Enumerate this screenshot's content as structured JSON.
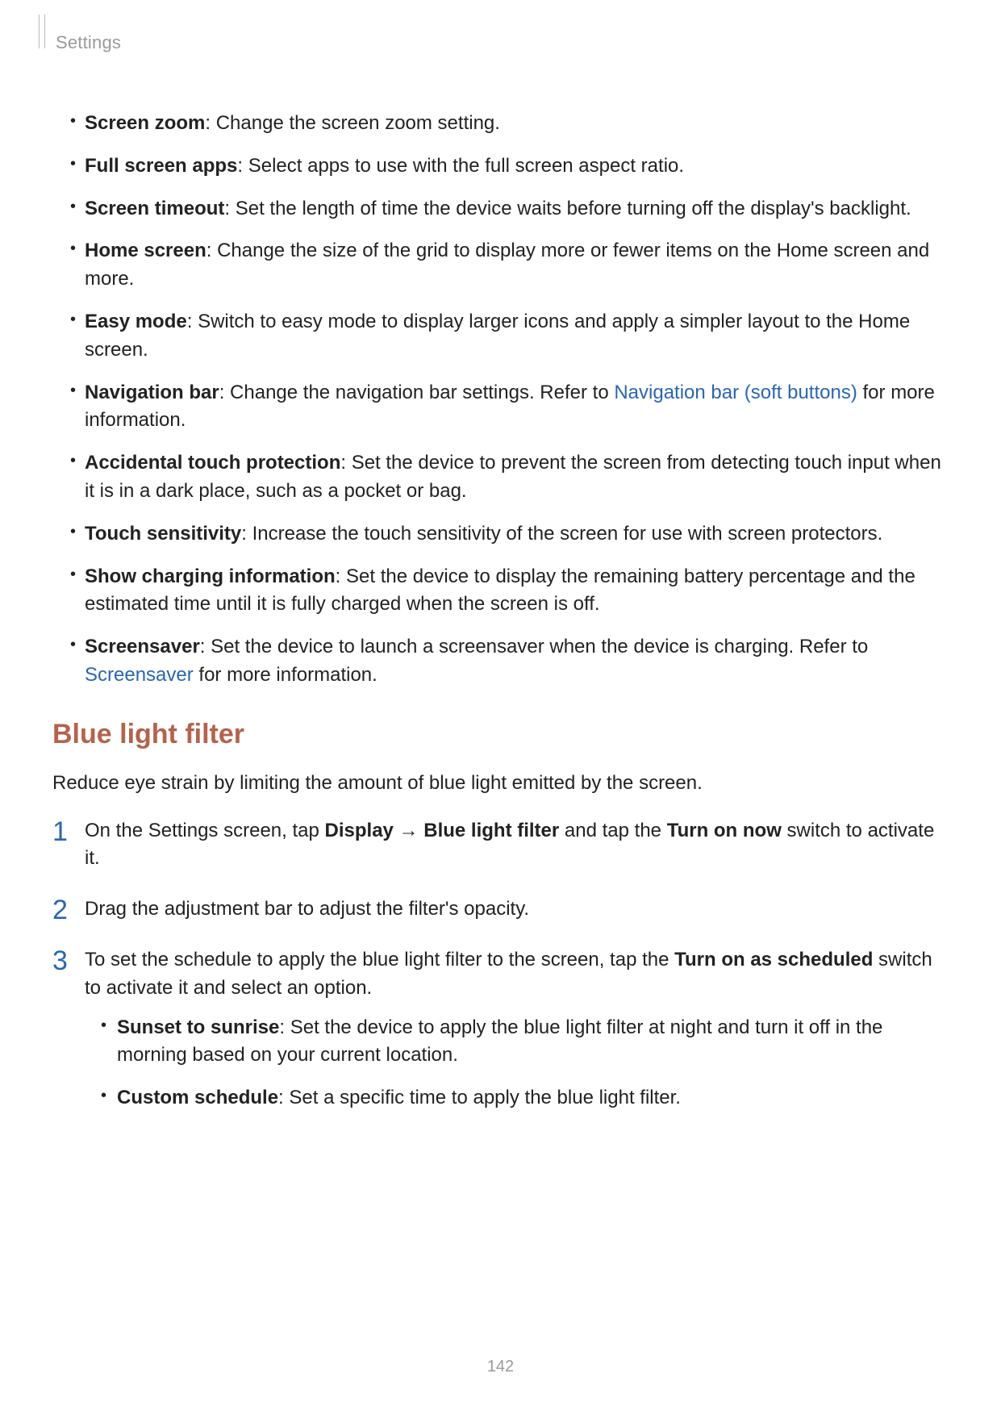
{
  "header": {
    "label": "Settings"
  },
  "bullets": [
    {
      "bold": "Screen zoom",
      "text": ": Change the screen zoom setting."
    },
    {
      "bold": "Full screen apps",
      "text": ": Select apps to use with the full screen aspect ratio."
    },
    {
      "bold": "Screen timeout",
      "text": ": Set the length of time the device waits before turning off the display's backlight."
    },
    {
      "bold": "Home screen",
      "text": ": Change the size of the grid to display more or fewer items on the Home screen and more."
    },
    {
      "bold": "Easy mode",
      "text": ": Switch to easy mode to display larger icons and apply a simpler layout to the Home screen."
    },
    {
      "bold": "Navigation bar",
      "text_before_link": ": Change the navigation bar settings. Refer to ",
      "link": "Navigation bar (soft buttons)",
      "text_after_link": " for more information."
    },
    {
      "bold": "Accidental touch protection",
      "text": ": Set the device to prevent the screen from detecting touch input when it is in a dark place, such as a pocket or bag."
    },
    {
      "bold": "Touch sensitivity",
      "text": ": Increase the touch sensitivity of the screen for use with screen protectors."
    },
    {
      "bold": "Show charging information",
      "text": ": Set the device to display the remaining battery percentage and the estimated time until it is fully charged when the screen is off."
    },
    {
      "bold": "Screensaver",
      "text_before_link": ": Set the device to launch a screensaver when the device is charging. Refer to ",
      "link": "Screensaver",
      "text_after_link": " for more information."
    }
  ],
  "section": {
    "heading": "Blue light filter",
    "intro": "Reduce eye strain by limiting the amount of blue light emitted by the screen."
  },
  "steps": {
    "s1": {
      "t1": "On the Settings screen, tap ",
      "b1": "Display",
      "arrow": " → ",
      "b2": "Blue light filter",
      "t2": " and tap the ",
      "b3": "Turn on now",
      "t3": " switch to activate it."
    },
    "s2": {
      "t1": "Drag the adjustment bar to adjust the filter's opacity."
    },
    "s3": {
      "t1": "To set the schedule to apply the blue light filter to the screen, tap the ",
      "b1": "Turn on as scheduled",
      "t2": " switch to activate it and select an option."
    }
  },
  "sub_bullets": {
    "sunset": {
      "bold": "Sunset to sunrise",
      "text": ": Set the device to apply the blue light filter at night and turn it off in the morning based on your current location."
    },
    "custom": {
      "bold": "Custom schedule",
      "text": ": Set a specific time to apply the blue light filter."
    }
  },
  "page_number": "142"
}
